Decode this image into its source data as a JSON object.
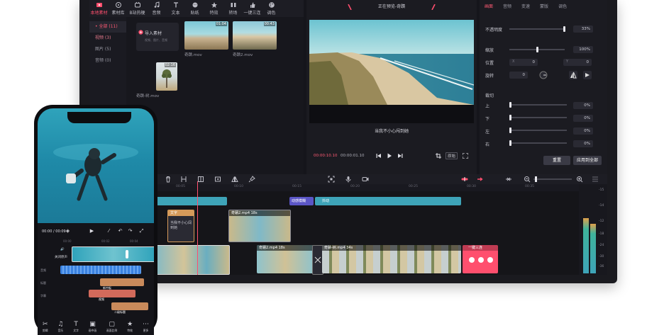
{
  "desktop": {
    "toolbar": [
      {
        "label": "本地素材",
        "icon": "media-icon",
        "active": true
      },
      {
        "label": "素材库",
        "icon": "library-icon",
        "active": false
      },
      {
        "label": "B站热梗",
        "icon": "bilibili-icon",
        "active": false
      },
      {
        "label": "音频",
        "icon": "music-icon",
        "active": false
      },
      {
        "label": "文本",
        "icon": "text-icon",
        "active": false
      },
      {
        "label": "贴纸",
        "icon": "sticker-icon",
        "active": false
      },
      {
        "label": "特效",
        "icon": "effect-icon",
        "active": false
      },
      {
        "label": "转场",
        "icon": "transition-icon",
        "active": false
      },
      {
        "label": "一键三连",
        "icon": "like-icon",
        "active": false
      },
      {
        "label": "调色",
        "icon": "palette-icon",
        "active": false
      }
    ],
    "media_sidebar": [
      {
        "label": "• 全部 (11)",
        "active": true
      },
      {
        "label": "视频 (3)",
        "active": false
      },
      {
        "label": "图片 (5)",
        "active": false
      },
      {
        "label": "音频 (0)",
        "active": false
      }
    ],
    "import": {
      "title": "导入素材",
      "subtitle": "视频、图片、音频"
    },
    "media_items": [
      {
        "name": "奇蹟.mov",
        "duration": "01:04"
      },
      {
        "name": "奇蹟2.mov",
        "duration": "00:43"
      },
      {
        "name": "奇蹟-树.mov",
        "duration": "02:16"
      }
    ],
    "player": {
      "title": "正在预览-奇蹟",
      "subtitle": "当我不小心闯到她",
      "current_time": "00:00:10.10",
      "total_time": "00:00:01.10",
      "ratio_label": "原始"
    },
    "properties": {
      "tabs": [
        "画面",
        "音频",
        "变速",
        "蒙版",
        "调色"
      ],
      "active_tab": "画面",
      "opacity_label": "不透明度",
      "opacity_value": "33%",
      "scale_label": "缩放",
      "scale_value": "100%",
      "position_label": "位置",
      "pos_x_label": "X",
      "pos_x": "0",
      "pos_y_label": "Y",
      "pos_y": "0",
      "rotate_label": "旋转",
      "rotate_value": "0",
      "crop_label": "裁切",
      "crop": [
        {
          "side": "上",
          "value": "0%"
        },
        {
          "side": "下",
          "value": "0%"
        },
        {
          "side": "左",
          "value": "0%"
        },
        {
          "side": "右",
          "value": "0%"
        }
      ],
      "reset_label": "重置",
      "apply_all_label": "应用到全部"
    },
    "timeline": {
      "ruler_labels": [
        "00:05",
        "00:10",
        "00:15",
        "00:20",
        "00:25",
        "00:30",
        "00:35"
      ],
      "text_clip_label": "文字",
      "text_clip_caption": "当我不小心闯到她",
      "clip_upper_label": "奇蹟2.mp4 18s",
      "effect_label_1": "动感模糊",
      "effect_label_2": "抖动",
      "clip_main_1": "奇蹟2.mp4 18s",
      "clip_main_2": "奇蹟-树.mp4 34s",
      "sticker_label": "一键三连",
      "meter_labels": [
        "-15",
        "-14",
        "-12",
        "-18",
        "-24",
        "-30",
        "-36"
      ]
    },
    "colors": {
      "accent": "#ff4f6e",
      "track_video": "#3ea4b8",
      "track_effect": "#5b56c6"
    }
  },
  "phone": {
    "time": "00:00 / 00:09",
    "ruler": [
      "00:00",
      "00:02",
      "00:04"
    ],
    "track_labels": [
      "音频",
      "关闭原声",
      "标题",
      "字幕"
    ],
    "text_chips": [
      "新中板",
      "视频",
      "二级标题"
    ],
    "bottom_nav": [
      {
        "label": "剪辑",
        "icon": "cut-icon"
      },
      {
        "label": "音乐",
        "icon": "music-icon"
      },
      {
        "label": "文字",
        "icon": "text-icon"
      },
      {
        "label": "画中画",
        "icon": "pip-icon"
      },
      {
        "label": "画面比例",
        "icon": "ratio-icon"
      },
      {
        "label": "特效",
        "icon": "effect-icon"
      },
      {
        "label": "更多",
        "icon": "more-icon"
      }
    ]
  }
}
